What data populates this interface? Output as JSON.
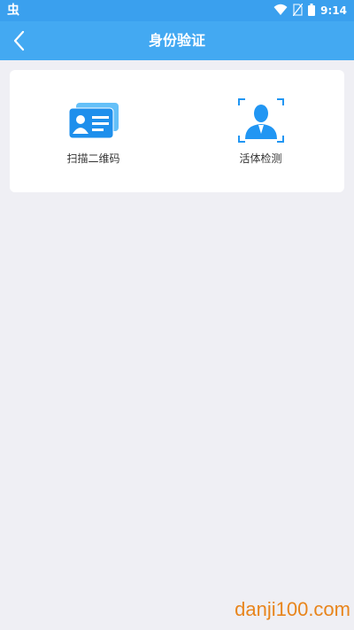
{
  "status_bar": {
    "app_icon_glyph": "虫",
    "time": "9:14",
    "icons": [
      "wifi-icon",
      "no-sim-icon",
      "battery-icon"
    ]
  },
  "header": {
    "title": "身份验证",
    "back_icon": "chevron-left-icon"
  },
  "options": [
    {
      "label": "扫描二维码",
      "icon": "id-card-icon"
    },
    {
      "label": "活体检测",
      "icon": "face-scan-icon"
    }
  ],
  "watermark": "danji100.com",
  "colors": {
    "status_bar": "#3aa0ee",
    "header": "#43a9f2",
    "background": "#efeff4",
    "card": "#ffffff",
    "icon_blue": "#2196f3",
    "watermark": "#e8851c"
  }
}
